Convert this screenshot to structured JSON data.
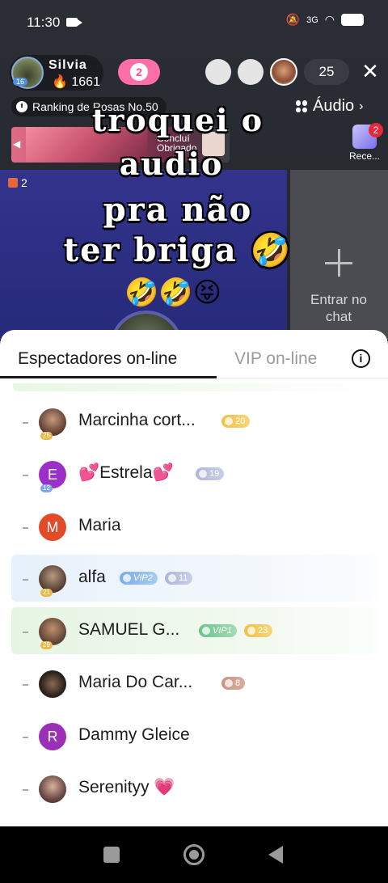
{
  "status_bar": {
    "time": "11:30",
    "battery": "37",
    "network": "3G"
  },
  "live": {
    "host_name": "Silvia",
    "host_level": "16",
    "host_fans": "🔥 1661",
    "heart_badge": "2",
    "viewer_count": "25",
    "ranking_label": "Ranking de Rosas No.50",
    "audio_label": "Áudio",
    "banner_text_1": "Concluí",
    "banner_text_2": "Obrigado",
    "recent_label": "Rece...",
    "recent_badge": "2",
    "gift_count": "2",
    "enter_chat_label": "Entrar no chat",
    "overlay_line_1": "troquei o",
    "overlay_line_2": "audio",
    "overlay_line_3": "pra não",
    "overlay_line_4": "ter briga 🤣",
    "overlay_emojis": "🤣🤣😝"
  },
  "sheet": {
    "tab_active": "Espectadores on-line",
    "tab_inactive": "VIP on-line",
    "viewers": [
      {
        "name": "Marcinha cort...",
        "level": "25",
        "badge": "20",
        "badge_type": "gold"
      },
      {
        "name": "💕Estrela💕",
        "level": "12",
        "badge": "19",
        "badge_type": "silver",
        "avatar_letter": "E"
      },
      {
        "name": "Maria",
        "avatar_letter": "M"
      },
      {
        "name": "alfa",
        "level": "21",
        "vip": "VIP2",
        "badge": "11",
        "badge_type": "silver"
      },
      {
        "name": "SAMUEL G...",
        "level": "29",
        "vip": "VIP1",
        "badge": "23",
        "badge_type": "gold"
      },
      {
        "name": "Maria Do Car...",
        "badge": "8",
        "badge_type": "brown"
      },
      {
        "name": "Dammy Gleice",
        "avatar_letter": "R"
      },
      {
        "name": "Serenityy 💗"
      }
    ]
  },
  "colors": {
    "accent_pink": "#ff6fa7",
    "video_blue": "#2f3187",
    "gold_badge": "#f2c04a",
    "vip_green": "#6cc28e"
  }
}
